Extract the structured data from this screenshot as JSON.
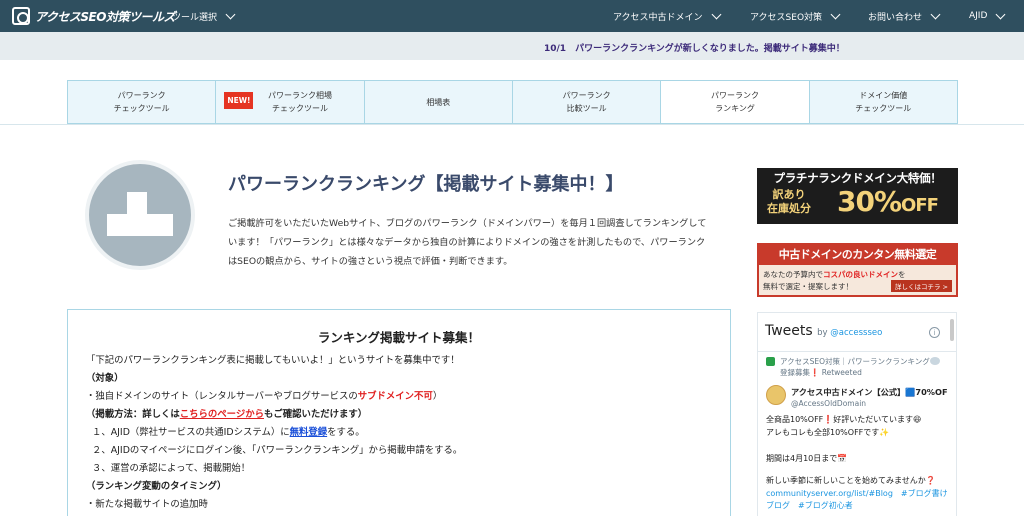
{
  "topnav": {
    "logo_text": "アクセスSEO対策ツールズ",
    "tool_select": "ツール選択",
    "items": [
      "アクセス中古ドメイン",
      "アクセスSEO対策",
      "お問い合わせ",
      "AJID"
    ]
  },
  "notice": {
    "text": "10/1　パワーランクランキングが新しくなりました。掲載サイト募集中！"
  },
  "tabs": [
    {
      "label": "パワーランク\nチェックツール"
    },
    {
      "label": "パワーランク相場\nチェックツール",
      "badge": "NEW!"
    },
    {
      "label": "相場表"
    },
    {
      "label": "パワーランク\n比較ツール"
    },
    {
      "label": "パワーランク\nランキング",
      "active": true
    },
    {
      "label": "ドメイン価値\nチェックツール"
    }
  ],
  "main": {
    "title": "パワーランクランキング【掲載サイト募集中！】",
    "intro": "ご掲載許可をいただいたWebサイト、ブログのパワーランク（ドメインパワー）を毎月１回調査してランキングしています！「パワーランク」とは様々なデータから独自の計算によりドメインの強さを計測したもので、パワーランクはSEOの観点から、サイトの強さという視点で評価・判断できます。"
  },
  "recruit": {
    "title": "ランキング掲載サイト募集！",
    "line1": "「下記のパワーランクランキング表に掲載してもいいよ！」というサイトを募集中です！",
    "target_heading": "（対象）",
    "target_prefix": "・独自ドメインのサイト（レンタルサーバーやブログサービスの",
    "target_red": "サブドメイン不可",
    "target_suffix": "）",
    "method_prefix": "（掲載方法：詳しくは",
    "method_link": "こちらのページから",
    "method_suffix": "もご確認いただけます）",
    "step1_prefix": "１、AJID（弊社サービスの共通IDシステム）に",
    "step1_link": "無料登録",
    "step1_suffix": "をする。",
    "step2": "２、AJIDのマイページにログイン後、「パワーランクランキング」から掲載申請をする。",
    "step3": "３、運営の承認によって、掲載開始！",
    "timing_heading": "（ランキング変動のタイミング）",
    "timing1": "・新たな掲載サイトの追加時"
  },
  "banner1": {
    "top": "プラチナランクドメイン大特価！",
    "left": "訳あり\n在庫処分",
    "percent": "30%",
    "off": "OFF"
  },
  "banner2": {
    "top": "中古ドメインのカンタン無料選定",
    "line1_prefix": "あなたの予算内で",
    "line1_hl": "コスパの良いドメイン",
    "line1_suffix": "を",
    "line2": "無料で選定・提案します！",
    "button": "詳しくはコチラ >"
  },
  "twitter": {
    "heading": "Tweets",
    "by": "by",
    "handle": "@accessseo",
    "retweet_text": "アクセスSEO対策｜パワーランクランキング登録募集❗ Retweeted",
    "name": "アクセス中古ドメイン【公式】🟦70%OF",
    "account": "@AccessOldDomain",
    "text_lines": [
      "全商品10%OFF❗好評いただいています😆",
      "アレもコレも全部10%OFFです✨",
      "",
      "期間は4月10日まで📅",
      "",
      "新しい季節に新しいことを始めてみませんか❓"
    ],
    "link_line1": "communityserver.org/list/#Blog　#ブログ書け　#",
    "link_line2": "ブログ　#ブログ初心者"
  }
}
